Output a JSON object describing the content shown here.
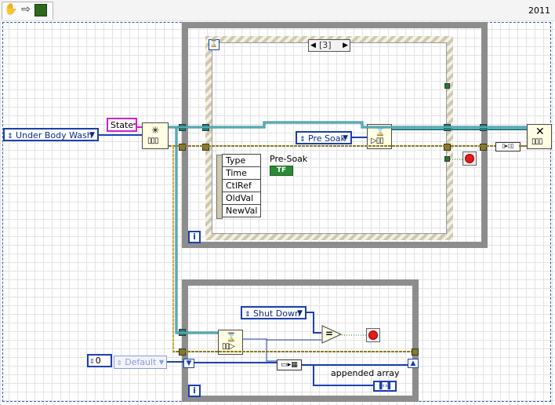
{
  "toolbar": {
    "run_icon": "operate-hand-icon",
    "arrow_icon": "arrow-right-icon",
    "highlight_icon": "run-highlight-icon",
    "version": "2011"
  },
  "state_init": {
    "enum_value": "Under Body Wash",
    "shift_label": "State"
  },
  "event_loop": {
    "case_selector": "[3]",
    "enqueue_enum": "Pre Soak",
    "event_fields": [
      "Type",
      "Time",
      "CtlRef",
      "OldVal",
      "NewVal"
    ],
    "boolean_label": "Pre-Soak",
    "boolean_text": "TF",
    "iteration": "i",
    "timeout": "⌛"
  },
  "consumer_loop": {
    "compare_enum": "Shut Down",
    "equals_symbol": "=",
    "numeric_value": "0",
    "default_value": "Default",
    "indicator_label": "appended array",
    "iteration": "i"
  },
  "colors": {
    "enum_blue": "#1c3fb0",
    "loop_gray": "#8d8d8d",
    "wire_teal": "#1f7f88",
    "wire_olive": "#8a7a24",
    "wire_pink": "#d21fc4",
    "stop_red": "#e21b1b"
  }
}
